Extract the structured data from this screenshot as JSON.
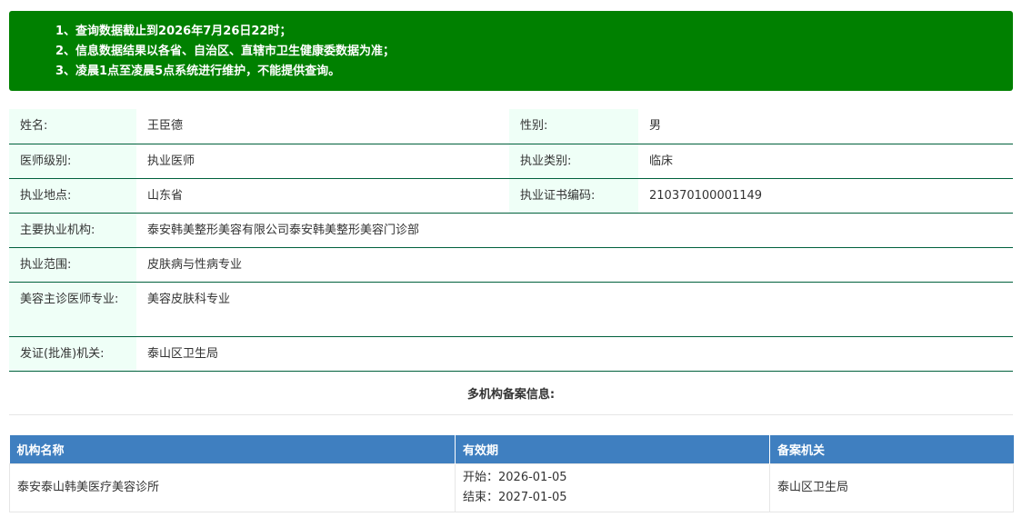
{
  "notice": {
    "lines": [
      "1、查询数据截止到2026年7月26日22时；",
      "2、信息数据结果以各省、自治区、直辖市卫生健康委数据为准；",
      "3、凌晨1点至凌晨5点系统进行维护，不能提供查询。"
    ]
  },
  "doctor": {
    "name_label": "姓名:",
    "name": "王臣德",
    "gender_label": "性别:",
    "gender": "男",
    "level_label": "医师级别:",
    "level": "执业医师",
    "type_label": "执业类别:",
    "type": "临床",
    "location_label": "执业地点:",
    "location": "山东省",
    "cert_label": "执业证书编码:",
    "cert": "210370100001149",
    "org_label": "主要执业机构:",
    "org": "泰安韩美整形美容有限公司泰安韩美整形美容门诊部",
    "scope_label": "执业范围:",
    "scope": "皮肤病与性病专业",
    "beauty_label": "美容主诊医师专业:",
    "beauty": "美容皮肤科专业",
    "issuer_label": "发证(批准)机关:",
    "issuer": "泰山区卫生局"
  },
  "multi": {
    "title": "多机构备案信息:",
    "headers": [
      "机构名称",
      "有效期",
      "备案机关"
    ],
    "rows": [
      {
        "org": "泰安泰山韩美医疗美容诊所",
        "start": "开始：2026-01-05",
        "end": "结束：2027-01-05",
        "authority": "泰山区卫生局"
      }
    ]
  },
  "colors": {
    "notice_bg": "#008000",
    "label_bg": "#effff7",
    "row_border": "#00603c",
    "grid_header_bg": "#3f7fc0"
  }
}
